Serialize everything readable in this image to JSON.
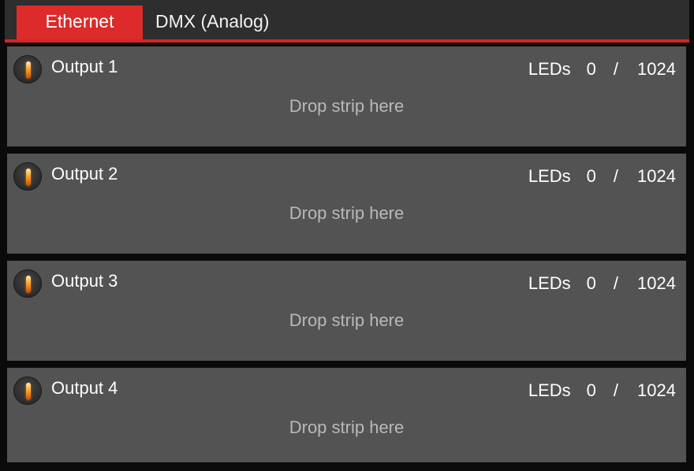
{
  "tabs": [
    {
      "label": "Ethernet",
      "active": true
    },
    {
      "label": "DMX (Analog)",
      "active": false
    }
  ],
  "outputs": [
    {
      "title": "Output 1",
      "leds_label": "LEDs",
      "leds_count": "0",
      "separator": "/",
      "leds_max": "1024",
      "drop_text": "Drop strip here"
    },
    {
      "title": "Output 2",
      "leds_label": "LEDs",
      "leds_count": "0",
      "separator": "/",
      "leds_max": "1024",
      "drop_text": "Drop strip here"
    },
    {
      "title": "Output 3",
      "leds_label": "LEDs",
      "leds_count": "0",
      "separator": "/",
      "leds_max": "1024",
      "drop_text": "Drop strip here"
    },
    {
      "title": "Output 4",
      "leds_label": "LEDs",
      "leds_count": "0",
      "separator": "/",
      "leds_max": "1024",
      "drop_text": "Drop strip here"
    }
  ],
  "icons": {
    "output": "led-strip-icon"
  },
  "colors": {
    "accent": "#dd2a2a",
    "panel": "#535353",
    "background": "#0a0a0a"
  }
}
